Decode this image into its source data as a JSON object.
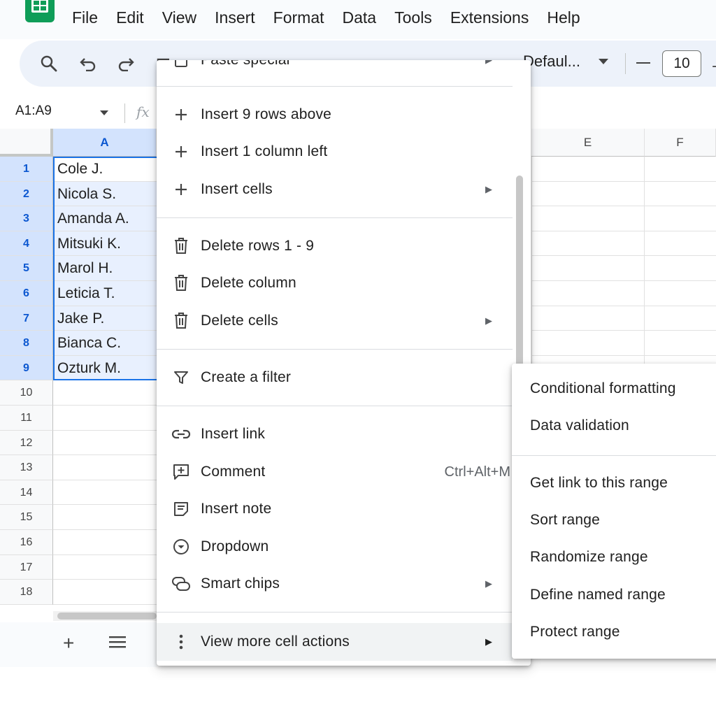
{
  "menubar": [
    "File",
    "Edit",
    "View",
    "Insert",
    "Format",
    "Data",
    "Tools",
    "Extensions",
    "Help"
  ],
  "toolbar": {
    "font": "Defaul...",
    "font_size": "10"
  },
  "formula": {
    "range": "A1:A9",
    "fx": "fx"
  },
  "columns": {
    "a": "A",
    "e": "E",
    "f": "F"
  },
  "rows": [
    {
      "num": "1",
      "a": "Cole J."
    },
    {
      "num": "2",
      "a": "Nicola S."
    },
    {
      "num": "3",
      "a": "Amanda A."
    },
    {
      "num": "4",
      "a": "Mitsuki K."
    },
    {
      "num": "5",
      "a": "Marol H."
    },
    {
      "num": "6",
      "a": "Leticia T."
    },
    {
      "num": "7",
      "a": "Jake P."
    },
    {
      "num": "8",
      "a": "Bianca C."
    },
    {
      "num": "9",
      "a": "Ozturk M."
    },
    {
      "num": "10",
      "a": ""
    },
    {
      "num": "11",
      "a": ""
    },
    {
      "num": "12",
      "a": ""
    },
    {
      "num": "13",
      "a": ""
    },
    {
      "num": "14",
      "a": ""
    },
    {
      "num": "15",
      "a": ""
    },
    {
      "num": "16",
      "a": ""
    },
    {
      "num": "17",
      "a": ""
    },
    {
      "num": "18",
      "a": ""
    }
  ],
  "context_menu": {
    "paste_special": "Paste special",
    "insert_rows": "Insert 9 rows above",
    "insert_column": "Insert 1 column left",
    "insert_cells": "Insert cells",
    "delete_rows": "Delete rows 1 - 9",
    "delete_column": "Delete column",
    "delete_cells": "Delete cells",
    "create_filter": "Create a filter",
    "insert_link": "Insert link",
    "comment": "Comment",
    "comment_shortcut": "Ctrl+Alt+M",
    "insert_note": "Insert note",
    "dropdown": "Dropdown",
    "smart_chips": "Smart chips",
    "view_more": "View more cell actions"
  },
  "submenu": {
    "conditional_formatting": "Conditional formatting",
    "data_validation": "Data validation",
    "get_link": "Get link to this range",
    "sort_range": "Sort range",
    "randomize_range": "Randomize range",
    "define_named_range": "Define named range",
    "protect_range": "Protect range"
  },
  "colors": {
    "selection": "#d3e3fd",
    "accent": "#1a73e8",
    "sheets_green": "#0f9d58"
  }
}
